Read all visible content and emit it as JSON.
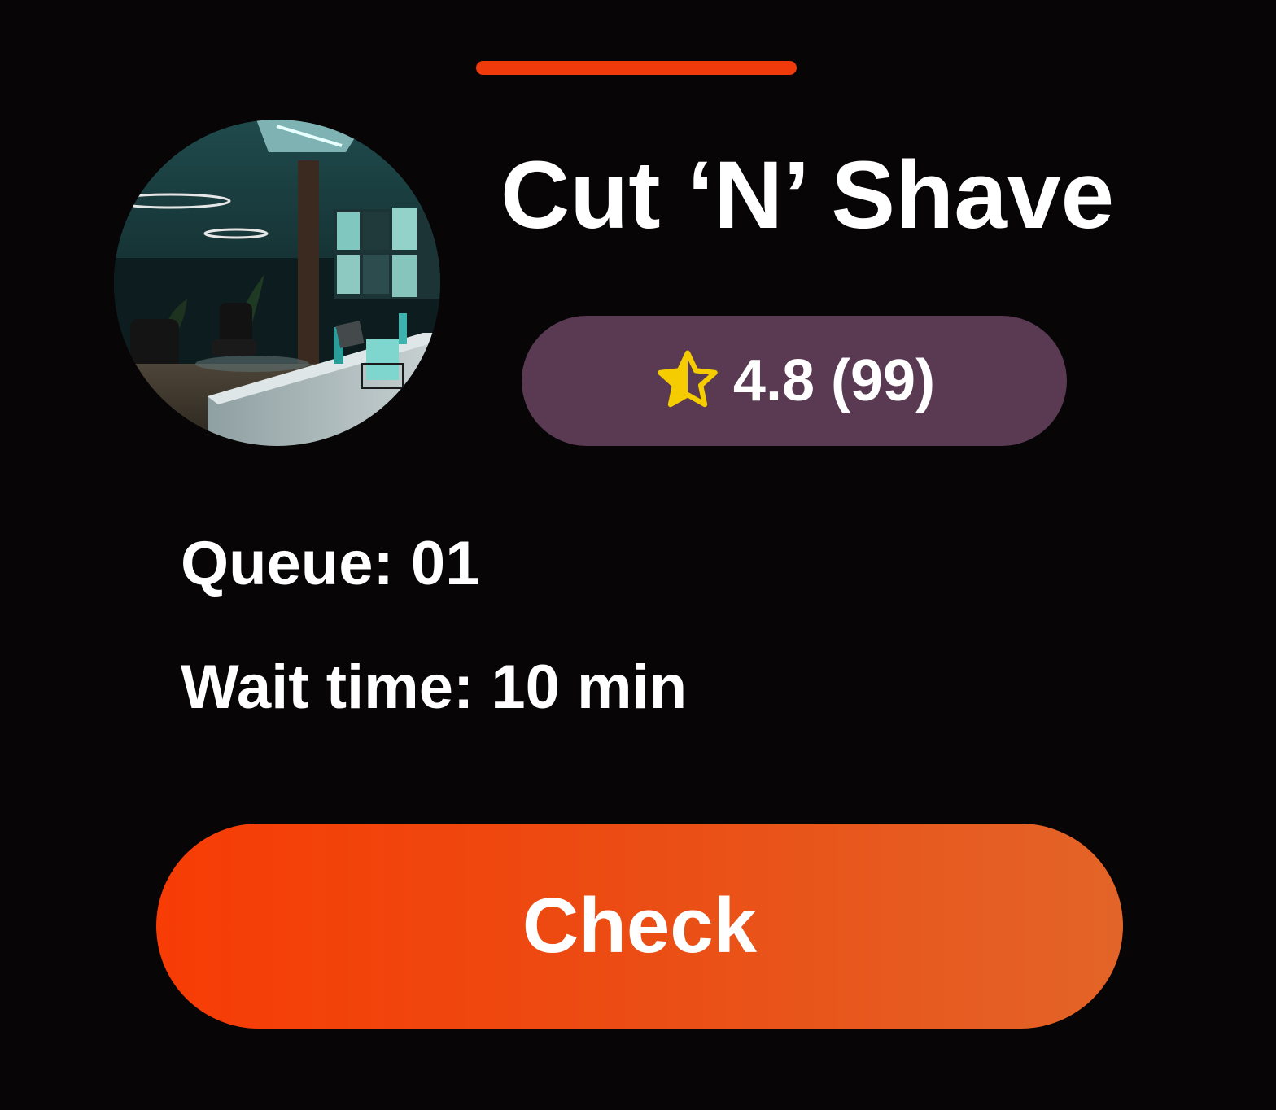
{
  "sheet": {
    "accent_color": "#f03a0c",
    "background_color": "#070505"
  },
  "shop": {
    "name": "Cut ‘N’ Shave",
    "photo_icon": "barbershop-interior-photo",
    "rating": {
      "icon": "star-half-icon",
      "star_color": "#f5cc00",
      "pill_color": "#5a3a52",
      "text": "4.8 (99)"
    },
    "queue_text": "Queue: 01",
    "wait_text": "Wait time: 10 min"
  },
  "actions": {
    "check_label": "Check"
  }
}
